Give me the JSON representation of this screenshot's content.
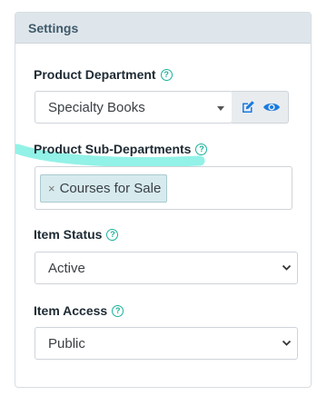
{
  "panel": {
    "title": "Settings"
  },
  "fields": {
    "department": {
      "label": "Product Department",
      "value": "Specialty Books"
    },
    "sub_departments": {
      "label": "Product Sub-Departments",
      "chips": [
        "Courses for Sale"
      ],
      "chip_remove": "×"
    },
    "status": {
      "label": "Item Status",
      "value": "Active"
    },
    "access": {
      "label": "Item Access",
      "value": "Public"
    }
  },
  "help_glyph": "?",
  "icons": {
    "help": "question-circle-icon",
    "edit": "edit-icon",
    "view": "eye-icon",
    "caret": "caret-down-icon",
    "chevron": "chevron-down-icon",
    "chip_remove": "close-icon"
  },
  "colors": {
    "accent": "#19b29b",
    "icon_blue": "#1a7be0",
    "header_bg": "#dfe6eb",
    "header_text": "#3f5a6a",
    "highlight": "#7ff0e3",
    "chip_bg": "#d7ebee"
  }
}
